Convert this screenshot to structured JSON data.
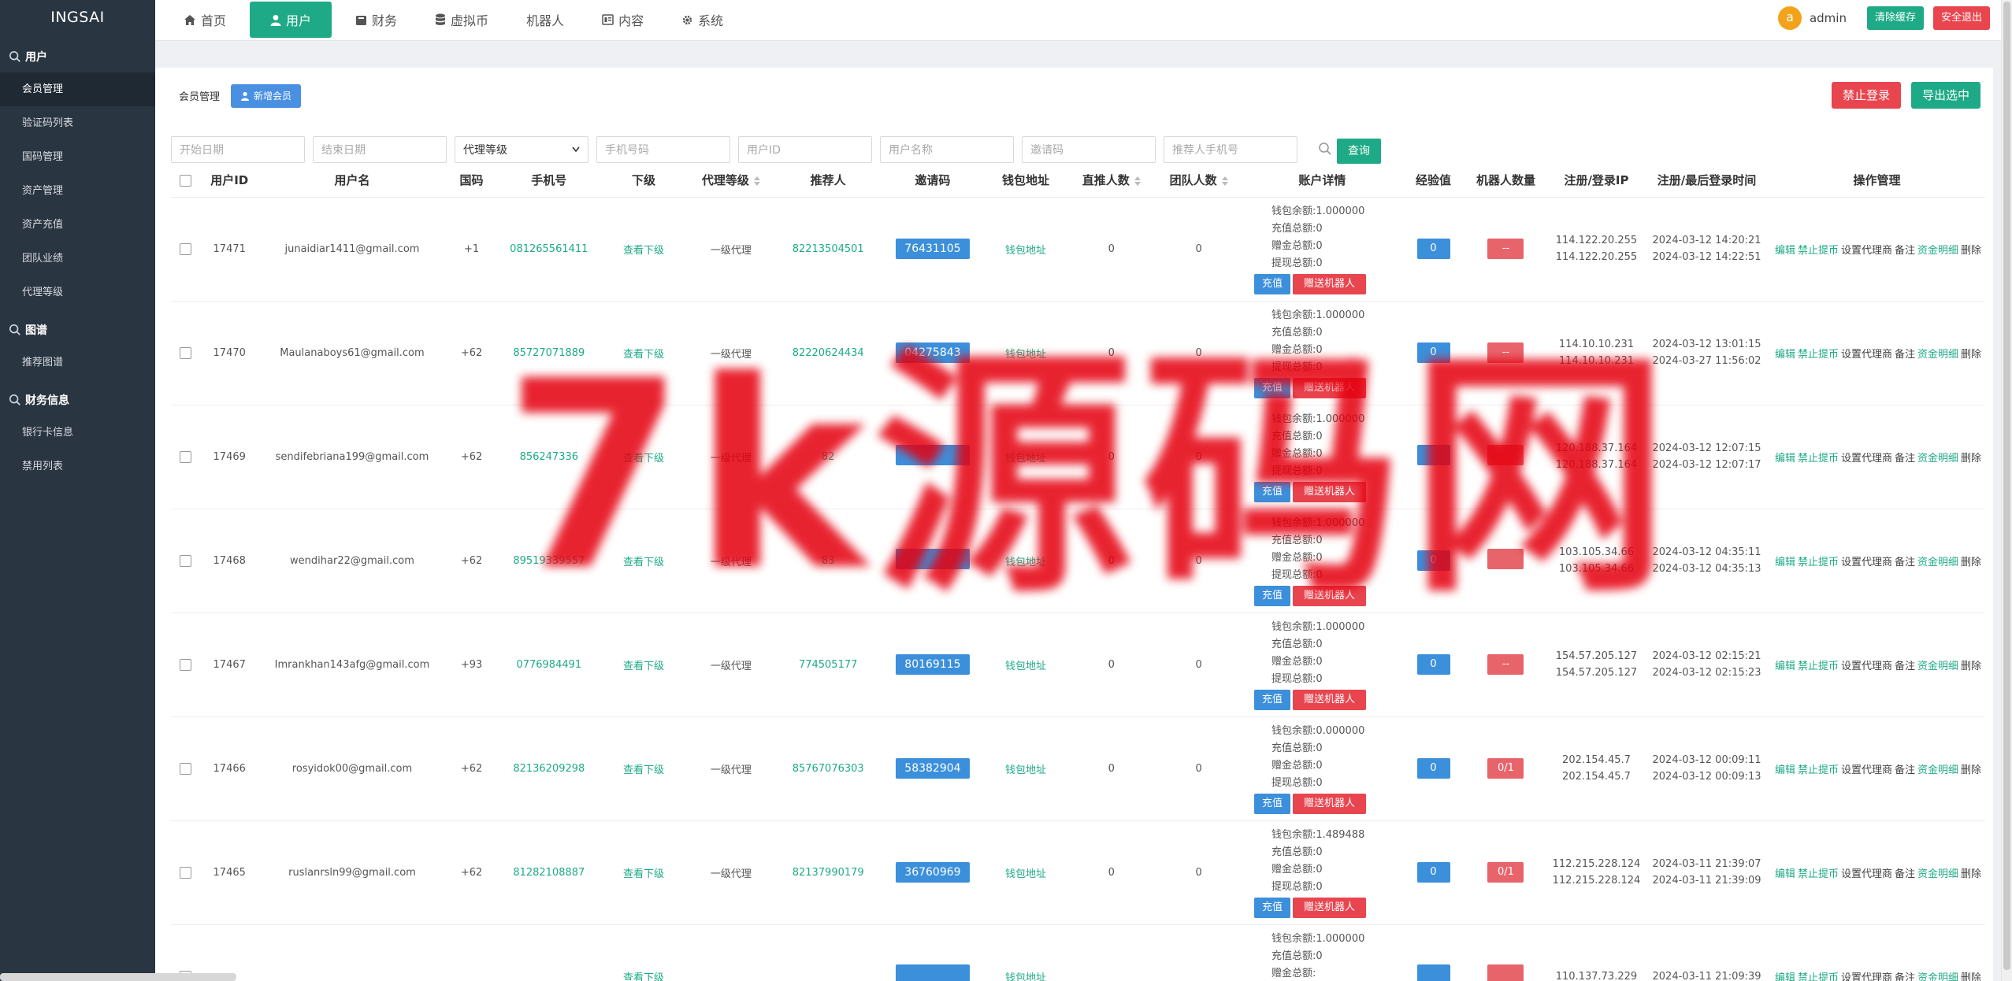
{
  "brand": "INGSAI",
  "sidebar": {
    "sections": [
      {
        "title": "用户",
        "items": [
          "会员管理",
          "验证码列表",
          "国码管理",
          "资产管理",
          "资产充值",
          "团队业绩",
          "代理等级"
        ]
      },
      {
        "title": "图谱",
        "items": [
          "推荐图谱"
        ]
      },
      {
        "title": "财务信息",
        "items": [
          "银行卡信息",
          "禁用列表"
        ]
      }
    ],
    "active_item": "会员管理"
  },
  "topnav": {
    "items": [
      {
        "label": "首页",
        "icon": "home-icon"
      },
      {
        "label": "用户",
        "icon": "user-icon",
        "active": true
      },
      {
        "label": "财务",
        "icon": "wallet-icon"
      },
      {
        "label": "虚拟币",
        "icon": "database-icon"
      },
      {
        "label": "机器人",
        "icon": ""
      },
      {
        "label": "内容",
        "icon": "content-icon"
      },
      {
        "label": "系统",
        "icon": "gear-icon"
      }
    ],
    "avatar_letter": "a",
    "admin_name": "admin",
    "clear_cache": "清除缓存",
    "logout": "安全退出"
  },
  "panel": {
    "title": "会员管理",
    "add_member": "新增会员",
    "ban_login": "禁止登录",
    "export_selected": "导出选中"
  },
  "filters": {
    "start_date": "开始日期",
    "end_date": "结束日期",
    "agent_level": "代理等级",
    "phone": "手机号码",
    "user_id": "用户ID",
    "user_name": "用户名称",
    "invite_code": "邀请码",
    "referrer_phone": "推荐人手机号",
    "query": "查询"
  },
  "table": {
    "headers": [
      "用户ID",
      "用户名",
      "国码",
      "手机号",
      "下级",
      "代理等级",
      "推荐人",
      "邀请码",
      "钱包地址",
      "直推人数",
      "团队人数",
      "账户详情",
      "经验值",
      "机器人数量",
      "注册/登录IP",
      "注册/最后登录时间",
      "操作管理"
    ],
    "acct_labels": {
      "balance": "钱包余额:",
      "recharge": "充值总额:",
      "gift": "赠金总额:",
      "withdraw": "提现总额:"
    },
    "row_buttons": {
      "sub": "查看下级",
      "wallet": "钱包地址",
      "recharge": "充值",
      "gift_robot": "赠送机器人"
    },
    "ops": {
      "edit": "编辑",
      "ban_withdraw": "禁止提币",
      "set_agent": "设置代理商",
      "note": "备注",
      "fund_detail": "资金明细",
      "delete": "删除"
    },
    "rows": [
      {
        "id": "17471",
        "name": "junaidiar1411@gmail.com",
        "cc": "+1",
        "phone": "081265561411",
        "level": "一级代理",
        "ref": "82213504501",
        "code": "76431105",
        "direct": "0",
        "team": "0",
        "balance": "1.000000",
        "recharge": "0",
        "gift": "0",
        "withdraw": "0",
        "exp": "0",
        "robots": "--",
        "ip1": "114.122.20.255",
        "ip2": "114.122.20.255",
        "t1": "2024-03-12 14:20:21",
        "t2": "2024-03-12 14:22:51"
      },
      {
        "id": "17470",
        "name": "Maulanaboys61@gmail.com",
        "cc": "+62",
        "phone": "85727071889",
        "level": "一级代理",
        "ref": "82220624434",
        "code": "04275843",
        "direct": "0",
        "team": "0",
        "balance": "1.000000",
        "recharge": "0",
        "gift": "0",
        "withdraw": "0",
        "exp": "0",
        "robots": "--",
        "ip1": "114.10.10.231",
        "ip2": "114.10.10.231",
        "t1": "2024-03-12 13:01:15",
        "t2": "2024-03-27 11:56:02"
      },
      {
        "id": "17469",
        "name": "sendifebriana199@gmail.com",
        "cc": "+62",
        "phone": "856247336",
        "level": "一级代理",
        "ref": "82",
        "code": "",
        "direct": "0",
        "team": "0",
        "balance": "1.000000",
        "recharge": "0",
        "gift": "0",
        "withdraw": "0",
        "exp": "",
        "robots": "",
        "ip1": "120.188.37.164",
        "ip2": "120.188.37.164",
        "t1": "2024-03-12 12:07:15",
        "t2": "2024-03-12 12:07:17"
      },
      {
        "id": "17468",
        "name": "wendihar22@gmail.com",
        "cc": "+62",
        "phone": "89519339557",
        "level": "一级代理",
        "ref": "83",
        "code": "",
        "direct": "0",
        "team": "0",
        "balance": "1.000000",
        "recharge": "0",
        "gift": "0",
        "withdraw": "0",
        "exp": "0",
        "robots": "",
        "ip1": "103.105.34.66",
        "ip2": "103.105.34.66",
        "t1": "2024-03-12 04:35:11",
        "t2": "2024-03-12 04:35:13"
      },
      {
        "id": "17467",
        "name": "Imrankhan143afg@gmail.com",
        "cc": "+93",
        "phone": "0776984491",
        "level": "一级代理",
        "ref": "774505177",
        "code": "80169115",
        "direct": "0",
        "team": "0",
        "balance": "1.000000",
        "recharge": "0",
        "gift": "0",
        "withdraw": "0",
        "exp": "0",
        "robots": "--",
        "ip1": "154.57.205.127",
        "ip2": "154.57.205.127",
        "t1": "2024-03-12 02:15:21",
        "t2": "2024-03-12 02:15:23"
      },
      {
        "id": "17466",
        "name": "rosyidok00@gmail.com",
        "cc": "+62",
        "phone": "82136209298",
        "level": "一级代理",
        "ref": "85767076303",
        "code": "58382904",
        "direct": "0",
        "team": "0",
        "balance": "0.000000",
        "recharge": "0",
        "gift": "0",
        "withdraw": "0",
        "exp": "0",
        "robots": "0/1",
        "ip1": "202.154.45.7",
        "ip2": "202.154.45.7",
        "t1": "2024-03-12 00:09:11",
        "t2": "2024-03-12 00:09:13"
      },
      {
        "id": "17465",
        "name": "ruslanrsln99@gmail.com",
        "cc": "+62",
        "phone": "81282108887",
        "level": "一级代理",
        "ref": "82137990179",
        "code": "36760969",
        "direct": "0",
        "team": "0",
        "balance": "1.489488",
        "recharge": "0",
        "gift": "0",
        "withdraw": "0",
        "exp": "0",
        "robots": "0/1",
        "ip1": "112.215.228.124",
        "ip2": "112.215.228.124",
        "t1": "2024-03-11 21:39:07",
        "t2": "2024-03-11 21:39:09"
      },
      {
        "id": "",
        "name": "",
        "cc": "",
        "phone": "",
        "level": "",
        "ref": "",
        "code": "",
        "direct": "",
        "team": "",
        "balance": "1.000000",
        "recharge": "0",
        "gift": "",
        "withdraw": "",
        "exp": "",
        "robots": "",
        "ip1": "110.137.73.229",
        "ip2": "",
        "t1": "2024-03-11 21:09:39",
        "t2": ""
      }
    ]
  },
  "watermark": "7k源码网",
  "colors": {
    "sidebar": "#2a3542",
    "accent_green": "#1eaa86",
    "danger_red": "#e8454f",
    "info_blue": "#3c8fdb"
  }
}
